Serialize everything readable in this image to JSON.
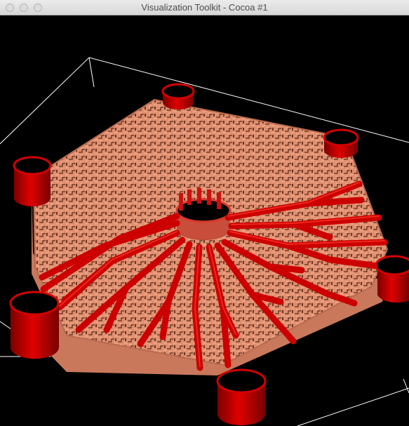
{
  "window": {
    "title": "Visualization Toolkit - Cocoa #1"
  },
  "viewport": {
    "background": "#000000",
    "outline_color": "#ffffff",
    "surface_color": "#e8967a",
    "surface_shadow_color": "#8a4a34",
    "vessel_color": "#d40000",
    "pillar_color": "#c00000"
  },
  "icons": {
    "close": "close-icon",
    "minimize": "minimize-icon",
    "maximize": "maximize-icon"
  }
}
